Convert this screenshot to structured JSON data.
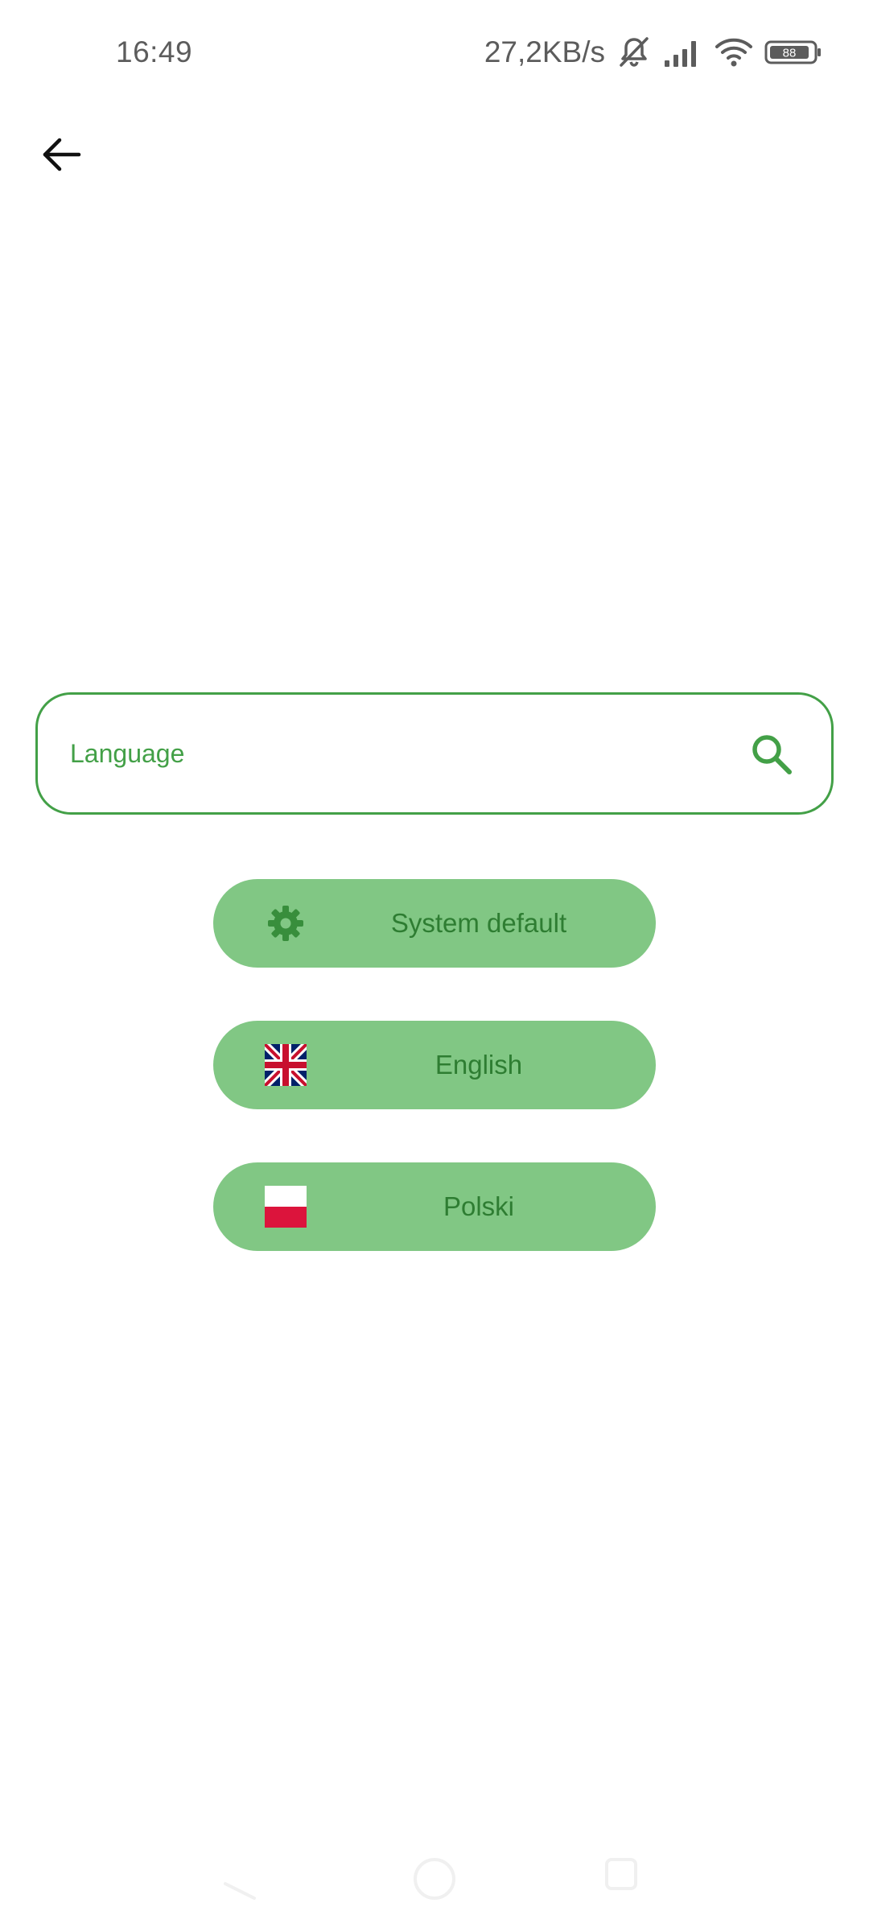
{
  "status_bar": {
    "time": "16:49",
    "net_speed": "27,2KB/s",
    "battery_level": "88",
    "icons": [
      "mute-bell-icon",
      "signal-icon",
      "wifi-icon",
      "battery-icon"
    ]
  },
  "toolbar": {
    "back_icon": "arrow-back-icon"
  },
  "search": {
    "placeholder": "Language",
    "value": "",
    "icon": "search-icon"
  },
  "languages": [
    {
      "label": "System default",
      "icon": "gear-icon"
    },
    {
      "label": "English",
      "icon": "uk-flag-icon"
    },
    {
      "label": "Polski",
      "icon": "poland-flag-icon"
    }
  ],
  "navigation_bar": {
    "icons": [
      "nav-back-icon",
      "nav-home-icon",
      "nav-recents-icon"
    ]
  },
  "colors": {
    "accent": "#43a047",
    "button_fill": "#81c784",
    "button_text": "#2e7d32",
    "status_text": "#5c5c5c"
  }
}
